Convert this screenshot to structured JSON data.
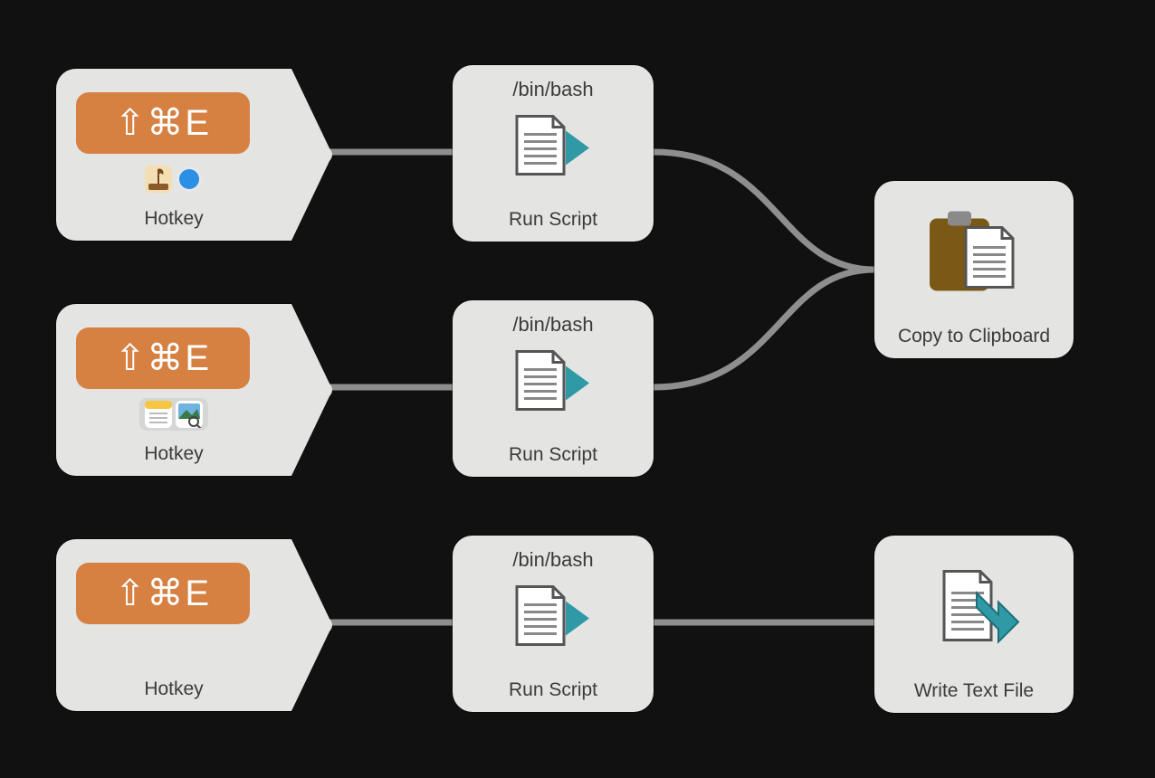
{
  "workflow": {
    "rows": [
      {
        "hotkey": {
          "shortcut": "⇧⌘E",
          "label": "Hotkey",
          "badge_bg": "#d68042",
          "apps": [
            "garageband",
            "safari"
          ],
          "apps_bordered": false
        },
        "script": {
          "header": "/bin/bash",
          "label": "Run Script"
        },
        "output": null
      },
      {
        "hotkey": {
          "shortcut": "⇧⌘E",
          "label": "Hotkey",
          "badge_bg": "#d68042",
          "apps": [
            "notes",
            "preview"
          ],
          "apps_bordered": true
        },
        "script": {
          "header": "/bin/bash",
          "label": "Run Script"
        },
        "output": null
      },
      {
        "hotkey": {
          "shortcut": "⇧⌘E",
          "label": "Hotkey",
          "badge_bg": "#d68042",
          "apps": [],
          "apps_bordered": false
        },
        "script": {
          "header": "/bin/bash",
          "label": "Run Script"
        },
        "output": {
          "kind": "write_file",
          "label": "Write Text File"
        }
      }
    ],
    "shared_output": {
      "kind": "clipboard",
      "label": "Copy to Clipboard"
    }
  },
  "colors": {
    "node_bg": "#e4e4e3",
    "badge_bg": "#d68042",
    "wire": "#8e8e8e",
    "arrow_teal": "#2f9aa6",
    "clipboard_board": "#7a5816"
  }
}
